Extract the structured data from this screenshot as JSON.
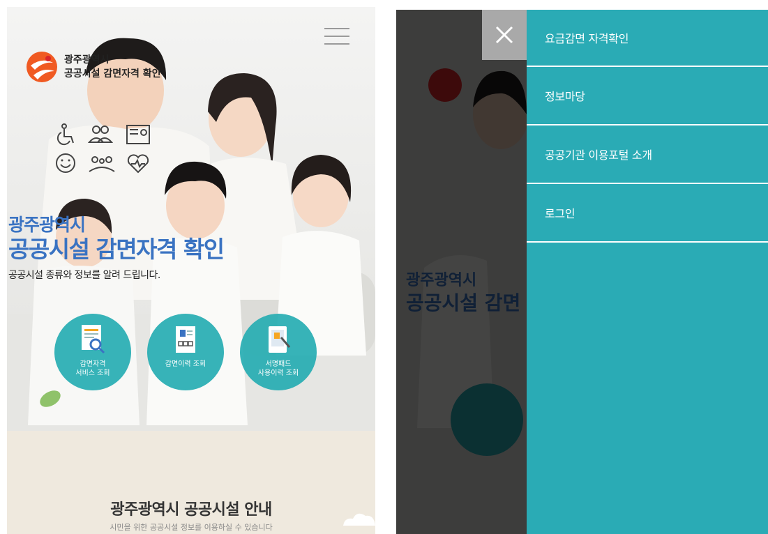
{
  "left_screen": {
    "logo": {
      "line1": "광주광역시",
      "line2": "공공시설 감면자격 확인"
    },
    "headline": {
      "line1": "광주광역시",
      "line2": "공공시설 감면자격 확인",
      "subtitle": "공공시설 종류와 정보를 알려 드립니다."
    },
    "quick_buttons": [
      {
        "label_line1": "감면자격",
        "label_line2": "서비스 조회",
        "icon": "document-search-icon"
      },
      {
        "label_line1": "감면이력 조회",
        "label_line2": "",
        "icon": "id-card-icon"
      },
      {
        "label_line1": "서명패드",
        "label_line2": "사용이력 조회",
        "icon": "signature-pad-icon"
      }
    ],
    "category_icons": [
      "wheelchair-icon",
      "people-group-icon",
      "id-card-icon",
      "smile-icon",
      "family-icon",
      "heartbeat-icon"
    ],
    "info": {
      "title": "광주광역시 공공시설 안내",
      "subtitle": "시민을 위한 공공시설 정보를 이용하실 수 있습니다"
    }
  },
  "right_screen": {
    "close_label": "×",
    "menu": [
      {
        "label": "요금감면 자격확인"
      },
      {
        "label": "정보마당"
      },
      {
        "label": "공공기관 이용포털 소개"
      },
      {
        "label": "로그인"
      }
    ]
  },
  "colors": {
    "teal": "#2aabb5",
    "heading_blue": "#3a73c2",
    "logo_orange": "#f05a22",
    "logo_red": "#d9252a"
  }
}
